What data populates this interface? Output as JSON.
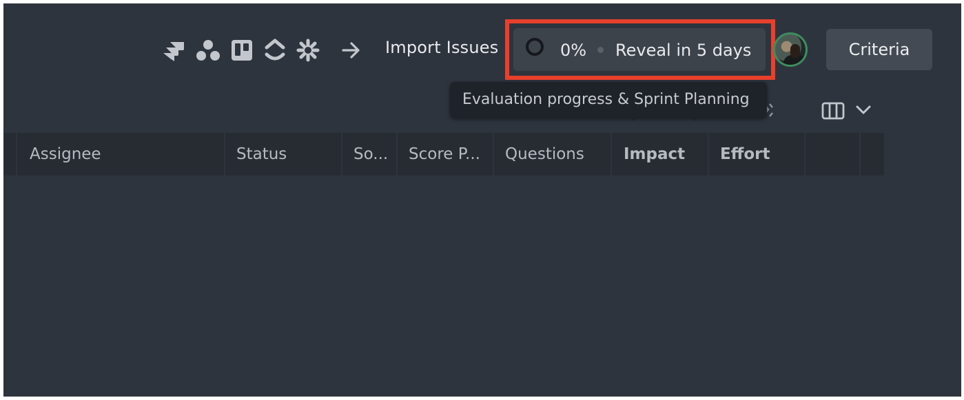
{
  "toolbar": {
    "integration_icons": [
      "jira-icon",
      "asana-icon",
      "trello-icon",
      "clickup-icon",
      "shortcut-icon"
    ],
    "import_label": "Import Issues",
    "progress": {
      "percent_label": "0%",
      "percent_value": 0,
      "reveal_label": "Reveal in 5 days"
    },
    "criteria_label": "Criteria"
  },
  "tooltip": {
    "text": "Evaluation progress & Sprint Planning"
  },
  "table": {
    "columns": [
      {
        "label": "Assignee",
        "bold": false
      },
      {
        "label": "Status",
        "bold": false
      },
      {
        "label": "So...",
        "bold": false
      },
      {
        "label": "Score P...",
        "bold": false
      },
      {
        "label": "Questions",
        "bold": false
      },
      {
        "label": "Impact",
        "bold": true
      },
      {
        "label": "Effort",
        "bold": true
      },
      {
        "label": "",
        "bold": false
      },
      {
        "label": "",
        "bold": false
      }
    ]
  },
  "colors": {
    "background": "#2e343d",
    "highlight": "#e8402c",
    "header_bg": "#272c33",
    "button_bg": "#434a53",
    "avatar_ring": "#3f8c60"
  }
}
